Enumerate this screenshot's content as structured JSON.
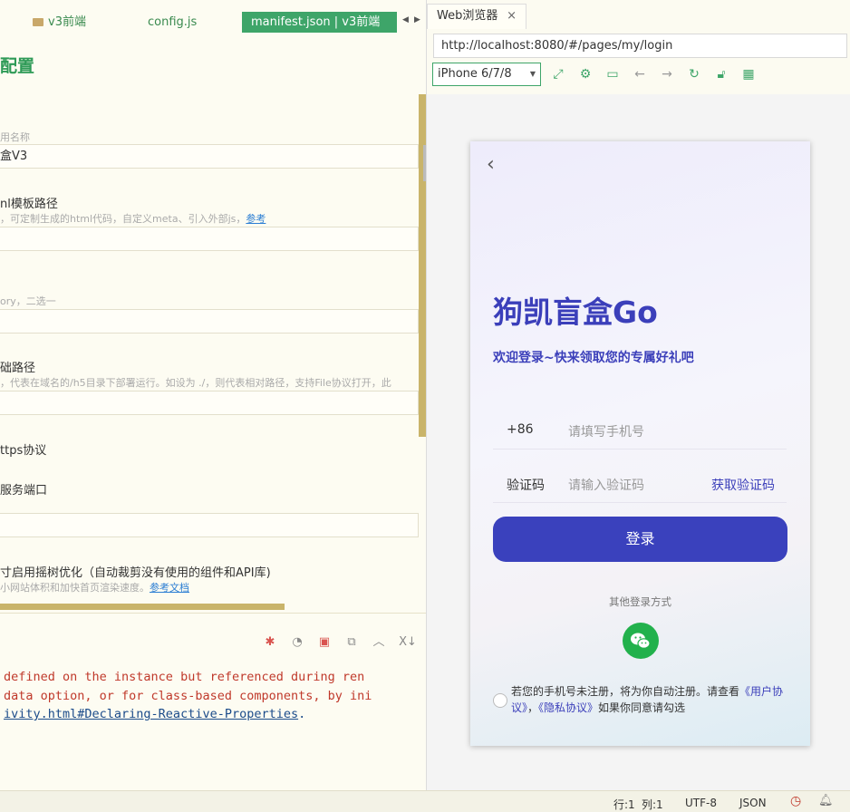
{
  "editor": {
    "tabs": {
      "folder_tab": "v3前端",
      "config_tab": "config.js",
      "active_tab": "manifest.json | v3前端"
    },
    "heading": "配置",
    "form": {
      "app_name_label": "用名称",
      "app_name_value": "盒V3",
      "template_label": "nl模板路径",
      "template_hint": "，可定制生成的html代码，自定义meta、引入外部js，",
      "template_link": "参考",
      "router_hint": "ory，二选一",
      "base_label": "础路径",
      "base_hint": "，代表在域名的/h5目录下部署运行。如设为 ./，则代表相对路径，支持File协议打开，此",
      "https_label": "ttps协议",
      "port_label": "服务端口",
      "treeshake_label": "寸启用摇树优化（自动裁剪没有使用的组件和API库)",
      "treeshake_hint": "小网站体积和加快首页渲染速度。",
      "treeshake_link": "参考文档"
    },
    "console": {
      "line1": "defined on the instance but referenced during ren",
      "line2": "data option, or for class-based components, by ini",
      "line3": "ivity.html#Declaring-Reactive-Properties",
      "line3_tail": "."
    }
  },
  "browser": {
    "tab_label": "Web浏览器",
    "tab_close": "×",
    "url": "http://localhost:8080/#/pages/my/login",
    "device": "iPhone 6/7/8",
    "page": {
      "brand": "狗凯盲盒Go",
      "welcome": "欢迎登录~快来领取您的专属好礼吧",
      "country_code": "+86",
      "phone_placeholder": "请填写手机号",
      "code_label": "验证码",
      "code_placeholder": "请输入验证码",
      "get_code": "获取验证码",
      "login_button": "登录",
      "other_login": "其他登录方式",
      "agreement_prefix": "若您的手机号未注册，将为你自动注册。请查看",
      "user_agreement": "《用户协议》",
      "agreement_sep": "，",
      "privacy_agreement": "《隐私协议》",
      "agreement_suffix": "如果你同意请勾选"
    }
  },
  "status_bar": {
    "line": "行:1",
    "col": "列:1",
    "encoding": "UTF-8",
    "language": "JSON"
  },
  "colors": {
    "accent": "#3ea569",
    "brand": "#3b3fba",
    "login_button": "#3a41bd",
    "console_error": "#c0392b"
  }
}
